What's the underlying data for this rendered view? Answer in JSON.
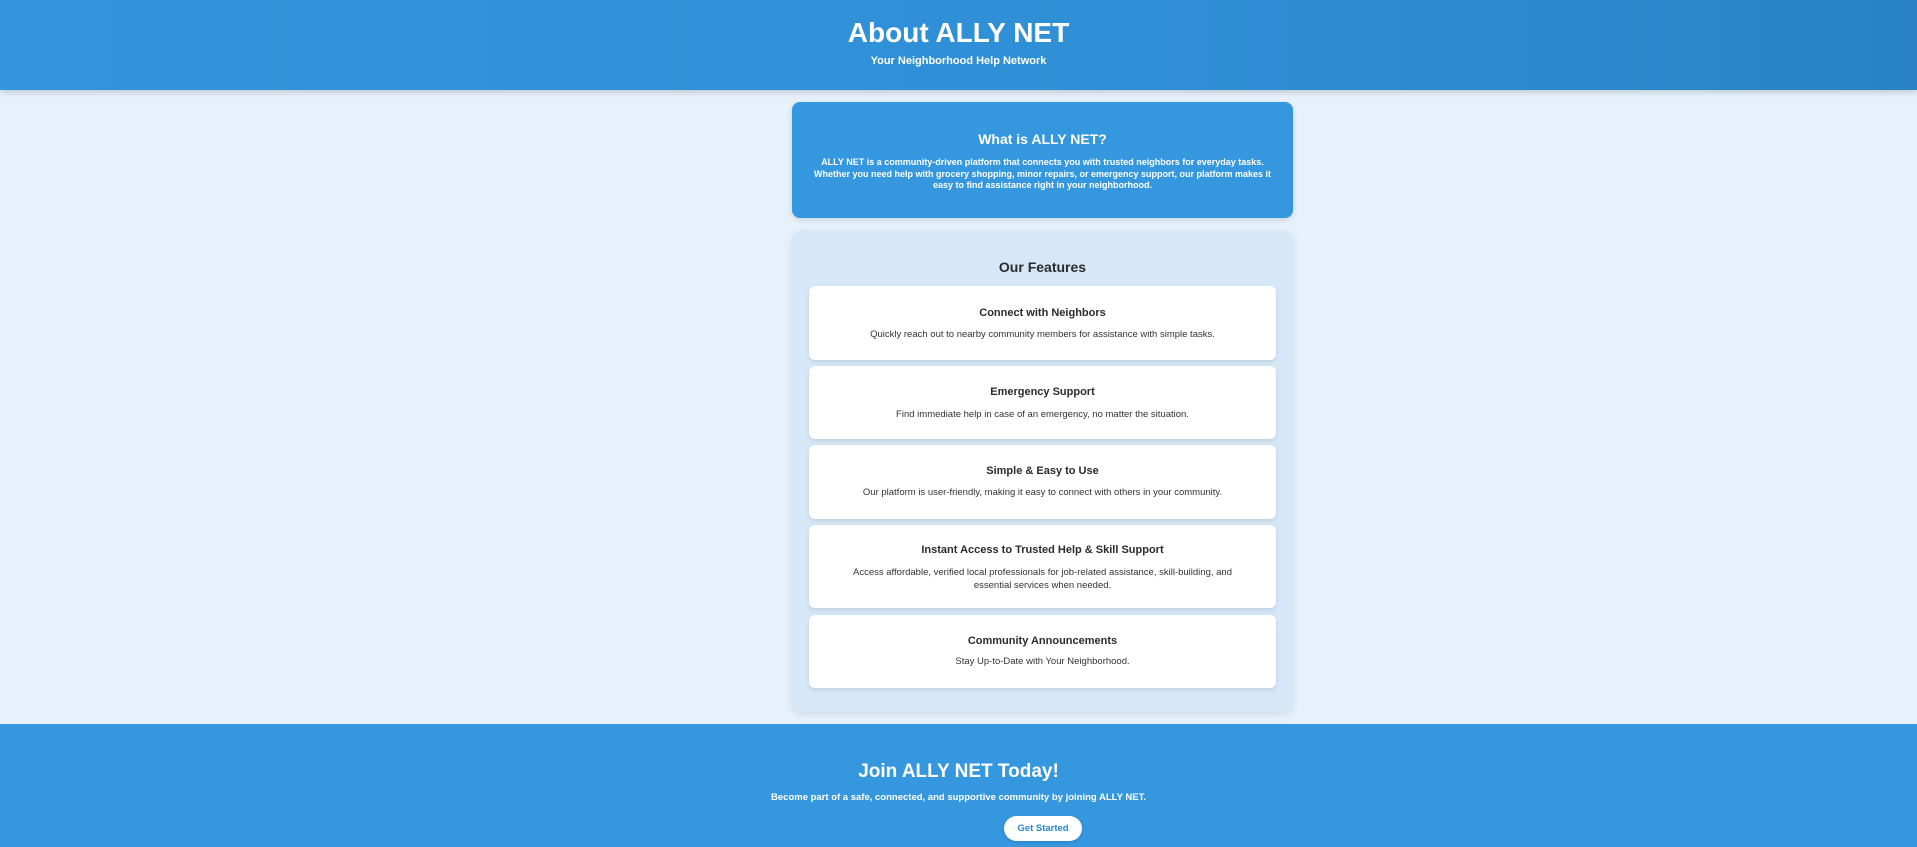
{
  "header": {
    "title": "About ALLY NET",
    "subtitle": "Your Neighborhood Help Network"
  },
  "intro": {
    "title": "What is ALLY NET?",
    "text": "ALLY NET is a community-driven platform that connects you with trusted neighbors for everyday tasks. Whether you need help with grocery shopping, minor repairs, or emergency support, our platform makes it easy to find assistance right in your neighborhood."
  },
  "features": {
    "title": "Our Features",
    "items": [
      {
        "title": "Connect with Neighbors",
        "description": "Quickly reach out to nearby community members for assistance with simple tasks."
      },
      {
        "title": "Emergency Support",
        "description": "Find immediate help in case of an emergency, no matter the situation."
      },
      {
        "title": "Simple & Easy to Use",
        "description": "Our platform is user-friendly, making it easy to connect with others in your community."
      },
      {
        "title": "Instant Access to Trusted Help & Skill Support",
        "description": "Access affordable, verified local professionals for job-related assistance, skill-building, and essential services when needed."
      },
      {
        "title": "Community Announcements",
        "description": "Stay Up-to-Date with Your Neighborhood."
      }
    ]
  },
  "cta": {
    "title": "Join ALLY NET Today!",
    "text": "Become part of a safe, connected, and supportive community by joining ALLY NET.",
    "button_label": "Get Started"
  },
  "colors": {
    "primary_blue": "#3597de",
    "page_background": "#e6f1fb",
    "panel_background": "#d6e7f7"
  }
}
